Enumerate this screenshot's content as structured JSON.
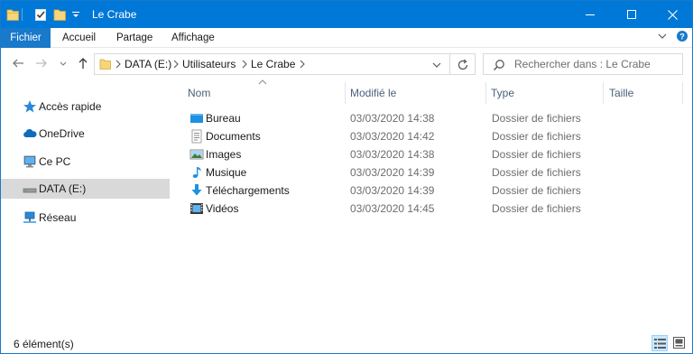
{
  "window": {
    "title": "Le Crabe",
    "accent": "#0078d7"
  },
  "quick_access_toolbar": {
    "icons": [
      "folder-icon",
      "properties-check-icon",
      "new-folder-icon",
      "customize-dropdown-icon"
    ]
  },
  "ribbon": {
    "tabs": [
      {
        "label": "Fichier",
        "active": true
      },
      {
        "label": "Accueil"
      },
      {
        "label": "Partage"
      },
      {
        "label": "Affichage"
      }
    ]
  },
  "navigation": {
    "breadcrumb": [
      "DATA (E:)",
      "Utilisateurs",
      "Le Crabe"
    ],
    "search_placeholder": "Rechercher dans : Le Crabe"
  },
  "sidebar": {
    "items": [
      {
        "label": "Accès rapide",
        "icon": "star-icon",
        "selected": false
      },
      {
        "label": "OneDrive",
        "icon": "cloud-icon",
        "selected": false
      },
      {
        "label": "Ce PC",
        "icon": "computer-icon",
        "selected": false
      },
      {
        "label": "DATA (E:)",
        "icon": "drive-icon",
        "selected": true
      },
      {
        "label": "Réseau",
        "icon": "network-icon",
        "selected": false
      }
    ]
  },
  "file_list": {
    "columns": [
      "Nom",
      "Modifié le",
      "Type",
      "Taille"
    ],
    "sorted_by": "Nom",
    "rows": [
      {
        "name": "Bureau",
        "modified": "03/03/2020 14:38",
        "type": "Dossier de fichiers",
        "icon": "desktop-folder-icon"
      },
      {
        "name": "Documents",
        "modified": "03/03/2020 14:42",
        "type": "Dossier de fichiers",
        "icon": "documents-folder-icon"
      },
      {
        "name": "Images",
        "modified": "03/03/2020 14:38",
        "type": "Dossier de fichiers",
        "icon": "pictures-folder-icon"
      },
      {
        "name": "Musique",
        "modified": "03/03/2020 14:39",
        "type": "Dossier de fichiers",
        "icon": "music-folder-icon"
      },
      {
        "name": "Téléchargements",
        "modified": "03/03/2020 14:39",
        "type": "Dossier de fichiers",
        "icon": "downloads-folder-icon"
      },
      {
        "name": "Vidéos",
        "modified": "03/03/2020 14:45",
        "type": "Dossier de fichiers",
        "icon": "videos-folder-icon"
      }
    ]
  },
  "status_bar": {
    "item_count": "6 élément(s)",
    "view_mode": "details"
  }
}
